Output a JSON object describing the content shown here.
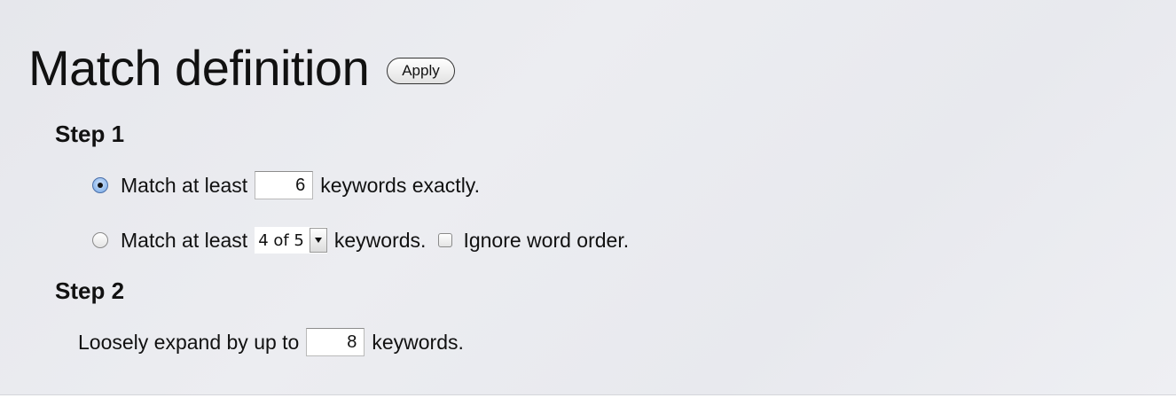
{
  "header": {
    "title": "Match definition",
    "apply_label": "Apply"
  },
  "step1": {
    "heading": "Step 1",
    "option_exact": {
      "selected": true,
      "prefix": "Match at least",
      "value": "6",
      "suffix": "keywords exactly."
    },
    "option_fuzzy": {
      "selected": false,
      "prefix": "Match at least",
      "select_value": "4 of 5",
      "suffix": "keywords.",
      "ignore_order_checked": false,
      "ignore_order_label": "Ignore word order."
    }
  },
  "step2": {
    "heading": "Step 2",
    "prefix": "Loosely expand by up to",
    "value": "8",
    "suffix": "keywords."
  },
  "icons": {
    "radio_selected": "radio-selected-icon",
    "dropdown": "chevron-down-icon"
  }
}
